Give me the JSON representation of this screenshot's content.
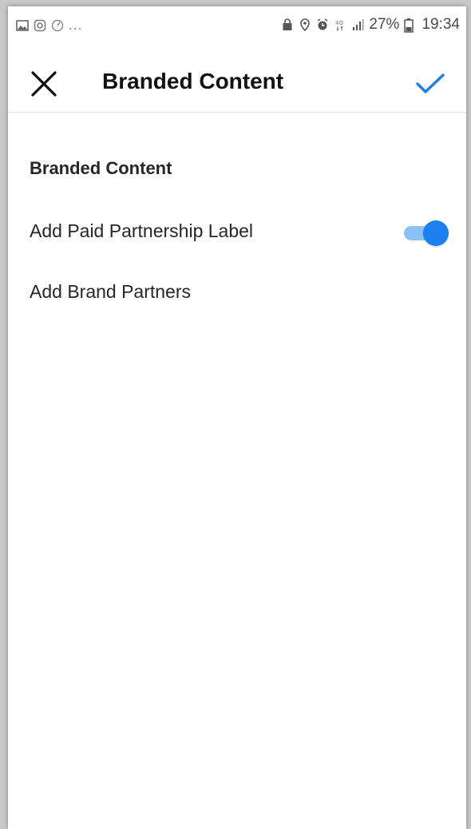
{
  "status_bar": {
    "left_icons": [
      "gallery-icon",
      "instagram-icon",
      "speed-icon"
    ],
    "overflow": "...",
    "right_icons": [
      "lock-icon",
      "location-icon",
      "alarm-icon",
      "4g-icon",
      "signal-icon"
    ],
    "battery_percent": "27%",
    "time": "19:34"
  },
  "header": {
    "title": "Branded Content",
    "close_icon": "close-icon",
    "confirm_icon": "check-icon",
    "accent_color": "#1c7ff0"
  },
  "content": {
    "section_heading": "Branded Content",
    "paid_partnership": {
      "label": "Add Paid Partnership Label",
      "enabled": true
    },
    "brand_partners": {
      "label": "Add Brand Partners"
    }
  }
}
